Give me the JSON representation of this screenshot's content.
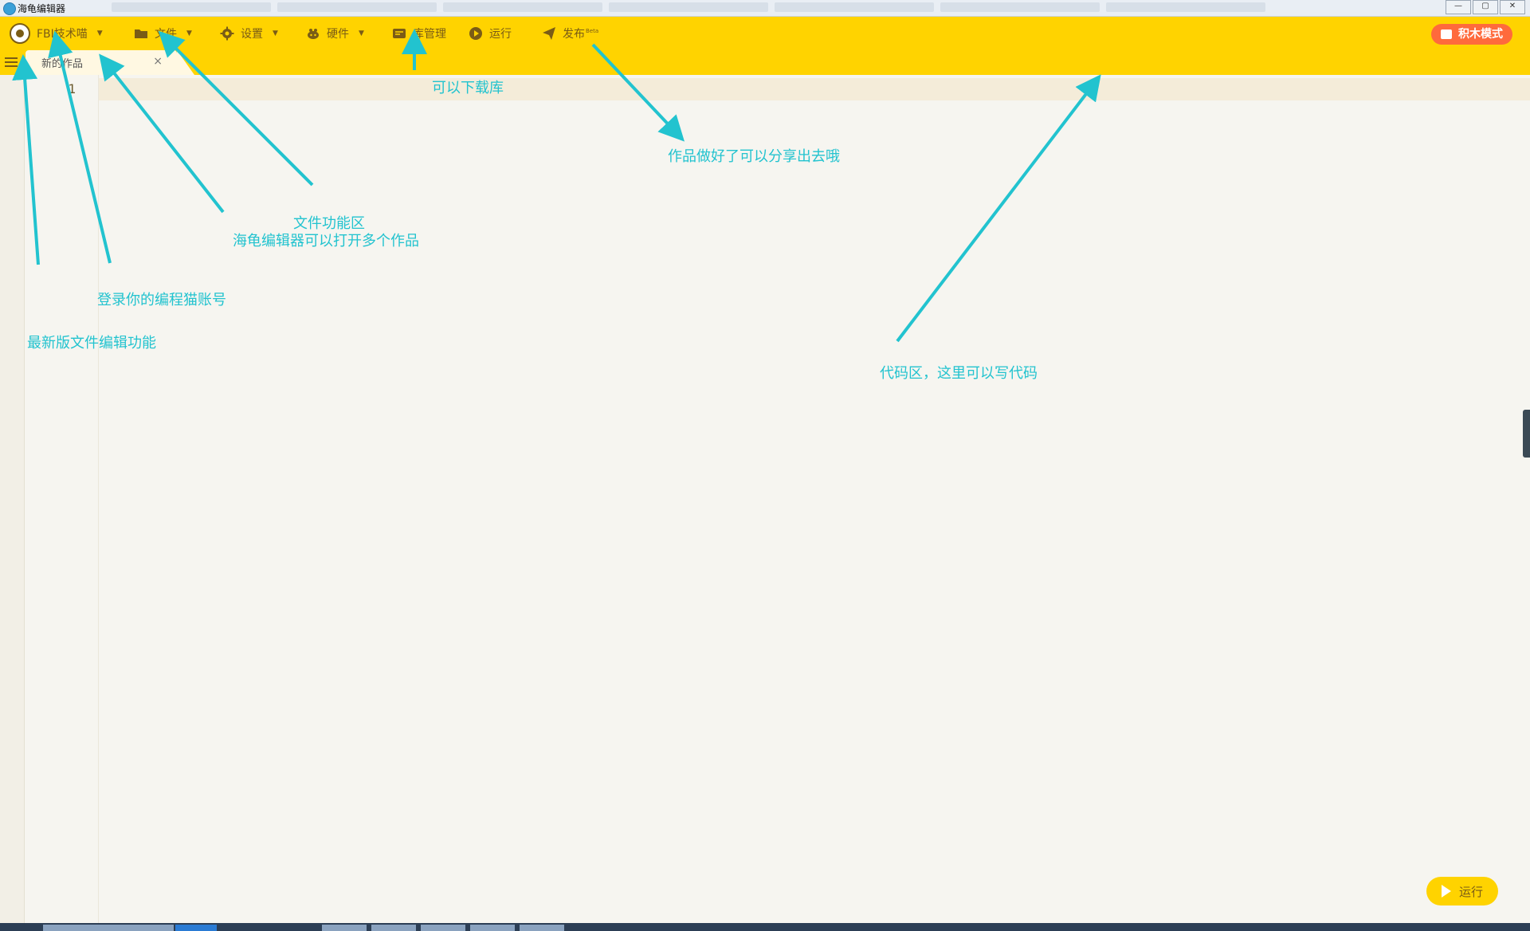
{
  "window": {
    "title": "海龟编辑器",
    "controls": [
      "—",
      "▢",
      "✕"
    ]
  },
  "toolbar": {
    "account_label": "FBI技术喵",
    "menus": [
      {
        "label": "文件",
        "icon": "folder-icon"
      },
      {
        "label": "设置",
        "icon": "gear-icon"
      },
      {
        "label": "硬件",
        "icon": "hardware-icon"
      },
      {
        "label": "库管理",
        "icon": "library-icon"
      },
      {
        "label": "运行",
        "icon": "play-circle-icon"
      },
      {
        "label": "发布",
        "icon": "paper-plane-icon",
        "badge": "Beta"
      }
    ],
    "block_mode_label": "积木模式"
  },
  "tabs": [
    {
      "label": "新的作品",
      "close": "×"
    }
  ],
  "editor": {
    "line_numbers": [
      "1"
    ]
  },
  "run_button_label": "运行",
  "annotations": {
    "library": "可以下载库",
    "publish": "作品做好了可以分享出去哦",
    "file_area": "文件功能区",
    "multi_tab": "海龟编辑器可以打开多个作品",
    "login": "登录你的编程猫账号",
    "latest_file": "最新版文件编辑功能",
    "code_area": "代码区，这里可以写代码"
  },
  "colors": {
    "toolbar": "#ffd300",
    "accent_text": "#7a5c16",
    "block_mode": "#ff6a3c",
    "annotation": "#22c3cf"
  }
}
